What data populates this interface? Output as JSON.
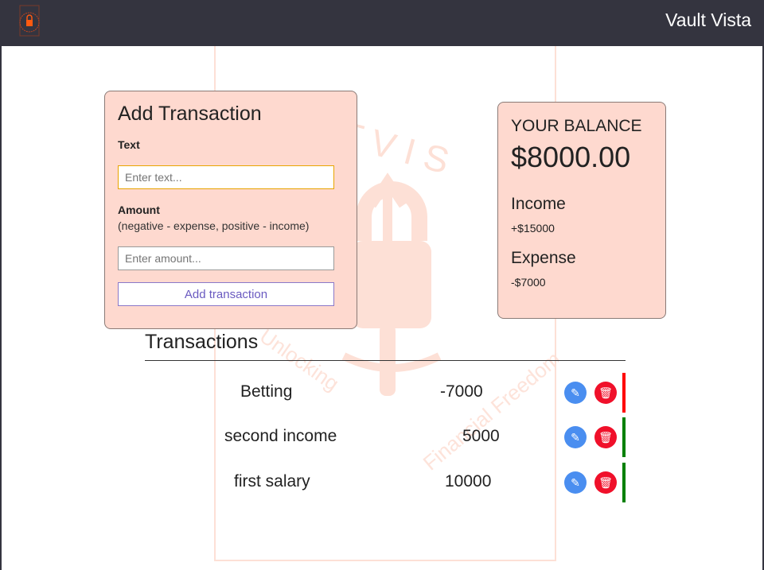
{
  "header": {
    "brand": "Vault Vista",
    "logo_text": "VAULT VISTA"
  },
  "watermark": {
    "top_text": "VAULT VISTA",
    "bottom_text": "Unlocking Financial Freedom"
  },
  "add_form": {
    "title": "Add Transaction",
    "text_label": "Text",
    "text_placeholder": "Enter text...",
    "amount_label": "Amount",
    "amount_hint": "(negative - expense, positive - income)",
    "amount_placeholder": "Enter amount...",
    "submit_label": "Add transaction"
  },
  "balance": {
    "title": "YOUR BALANCE",
    "value": "$8000.00",
    "income_label": "Income",
    "income_value": "+$15000",
    "expense_label": "Expense",
    "expense_value": "-$7000"
  },
  "transactions": {
    "title": "Transactions",
    "items": [
      {
        "name": "Betting",
        "amount": "-7000",
        "color": "#ff0000"
      },
      {
        "name": "second income",
        "amount": "5000",
        "color": "#008000"
      },
      {
        "name": "first salary",
        "amount": "10000",
        "color": "#008000"
      }
    ]
  },
  "colors": {
    "card": "#fed9cf",
    "header": "#34343f",
    "edit": "#4a8ef0",
    "delete": "#f0102a"
  }
}
